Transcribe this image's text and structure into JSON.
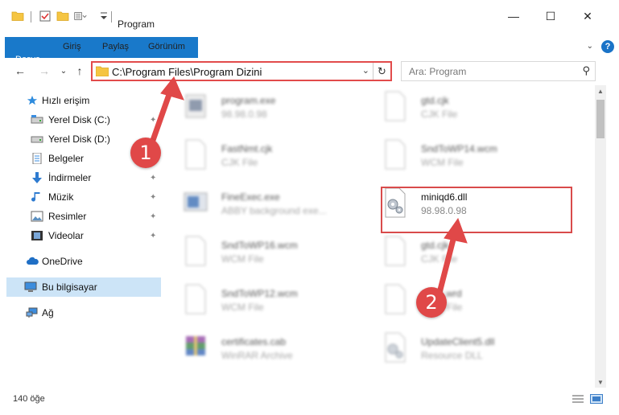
{
  "window": {
    "title": "Program",
    "minimize": "—",
    "maximize": "☐",
    "close": "✕"
  },
  "ribbon": {
    "tabs": [
      "Dosya",
      "Giriş",
      "Paylaş",
      "Görünüm"
    ],
    "expand_glyph": "⌄",
    "help_glyph": "?"
  },
  "navigation": {
    "back": "←",
    "forward": "→",
    "recent": "⌄",
    "up": "↑",
    "address_path": "C:\\Program Files\\Program Dizini",
    "address_dropdown": "⌄",
    "refresh": "↻",
    "search_placeholder": "Ara: Program",
    "search_icon": "⚲"
  },
  "sidebar": {
    "items": [
      {
        "label": "Hızlı erişim",
        "icon": "star-icon",
        "pinned": false
      },
      {
        "label": "Yerel Disk (C:)",
        "icon": "drive-icon",
        "pinned": true
      },
      {
        "label": "Yerel Disk (D:)",
        "icon": "drive-icon",
        "pinned": true
      },
      {
        "label": "Belgeler",
        "icon": "documents-icon",
        "pinned": true
      },
      {
        "label": "İndirmeler",
        "icon": "download-icon",
        "pinned": true
      },
      {
        "label": "Müzik",
        "icon": "music-icon",
        "pinned": true
      },
      {
        "label": "Resimler",
        "icon": "pictures-icon",
        "pinned": true
      },
      {
        "label": "Videolar",
        "icon": "video-icon",
        "pinned": true
      },
      {
        "label": "OneDrive",
        "icon": "cloud-icon",
        "pinned": false
      },
      {
        "label": "Bu bilgisayar",
        "icon": "computer-icon",
        "pinned": false,
        "selected": true
      },
      {
        "label": "Ağ",
        "icon": "network-icon",
        "pinned": false
      }
    ],
    "pin_glyph": "📌"
  },
  "files": [
    {
      "name": "program.exe",
      "sub": "98.98.0.98",
      "icon": "exe-icon",
      "blurred": true
    },
    {
      "name": "gtd.cjk",
      "sub": "CJK File",
      "icon": "blank-file-icon",
      "blurred": true
    },
    {
      "name": "FastNmt.cjk",
      "sub": "CJK File",
      "icon": "blank-file-icon",
      "blurred": true
    },
    {
      "name": "SndToWP14.wcm",
      "sub": "WCM File",
      "icon": "blank-file-icon",
      "blurred": true
    },
    {
      "name": "FineExec.exe",
      "sub": "ABBY background exe...",
      "icon": "app-icon",
      "blurred": true
    },
    {
      "name": "miniqd6.dll",
      "sub": "98.98.0.98",
      "icon": "dll-gear-icon",
      "blurred": false
    },
    {
      "name": "SndToWP16.wcm",
      "sub": "WCM File",
      "icon": "blank-file-icon",
      "blurred": true
    },
    {
      "name": "gtd.cjk",
      "sub": "CJK File",
      "icon": "blank-file-icon",
      "blurred": true
    },
    {
      "name": "SndToWP12.wcm",
      "sub": "WCM File",
      "icon": "blank-file-icon",
      "blurred": true
    },
    {
      "name": "mllec.wrd",
      "sub": "WRD File",
      "icon": "blank-file-icon",
      "blurred": true
    },
    {
      "name": "certificates.cab",
      "sub": "WinRAR Archive",
      "icon": "archive-icon",
      "blurred": true
    },
    {
      "name": "UpdateClient5.dll",
      "sub": "Resource DLL",
      "icon": "dll-gear-icon",
      "blurred": true
    }
  ],
  "status": {
    "item_count": "140 öğe"
  },
  "annotations": {
    "step1": "1",
    "step2": "2",
    "color": "#e04848"
  },
  "colors": {
    "accent": "#1979ca",
    "selection": "#cce4f7",
    "highlight_border": "#d94b4b"
  }
}
